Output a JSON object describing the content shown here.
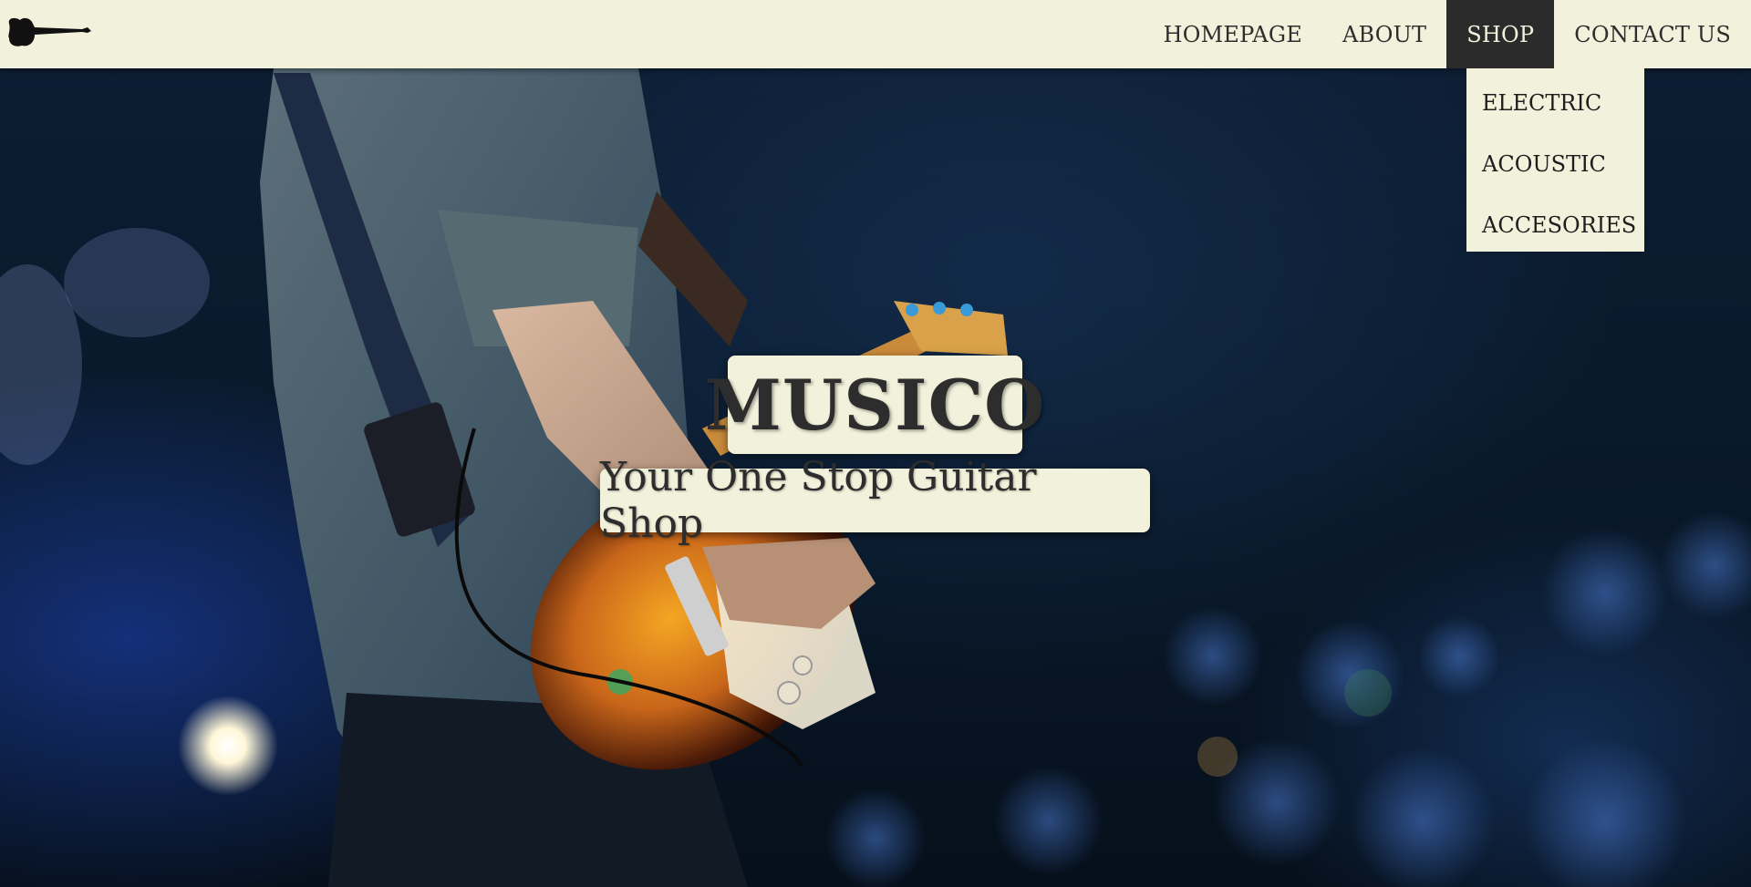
{
  "brand": {
    "logo_icon": "guitar-icon"
  },
  "nav": {
    "items": [
      {
        "label": "HOMEPAGE",
        "active": false
      },
      {
        "label": "ABOUT",
        "active": false
      },
      {
        "label": "SHOP",
        "active": true
      },
      {
        "label": "CONTACT US",
        "active": false
      }
    ],
    "shop_dropdown": [
      {
        "label": "ELECTRIC"
      },
      {
        "label": "ACOUSTIC"
      },
      {
        "label": "ACCESORIES"
      }
    ]
  },
  "hero": {
    "title": "MUSICO",
    "subtitle": "Your One Stop Guitar Shop"
  },
  "colors": {
    "nav_background": "#f2f2dc",
    "nav_active_background": "#2b2b2b",
    "text_dark": "#2d2d2d",
    "hero_dark": "#0a1a2c"
  }
}
